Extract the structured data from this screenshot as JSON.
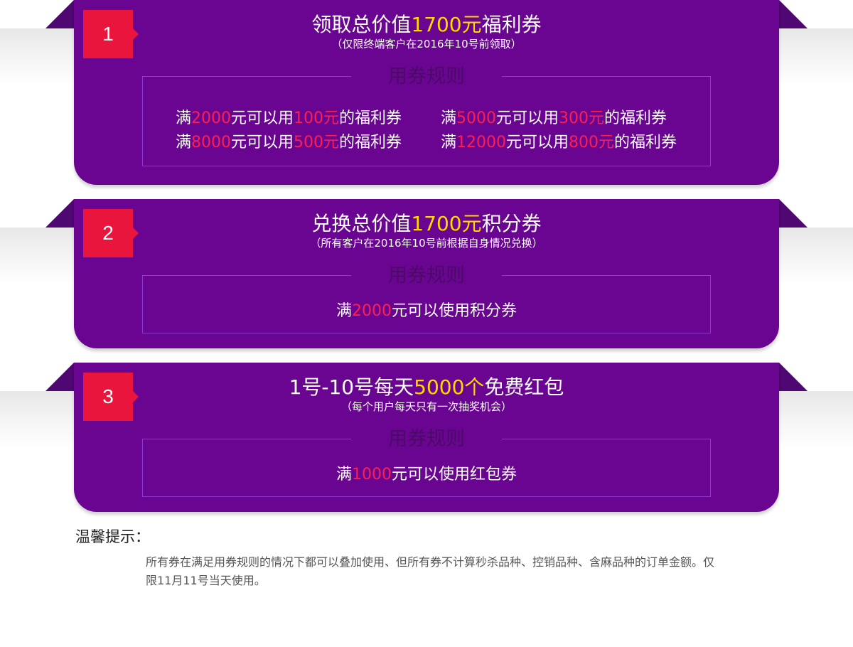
{
  "offers": [
    {
      "badge": "1",
      "title": {
        "before": "领取总价值",
        "highlight": "1700元",
        "after": "福利券"
      },
      "subtitle": "（仅限终端客户在2016年10号前领取）",
      "rules_header": "用券规则",
      "rules": [
        {
          "p1": "满",
          "amt": "2000",
          "p2": "元可以用",
          "val": "100元",
          "p3": "的福利券"
        },
        {
          "p1": "满",
          "amt": "5000",
          "p2": "元可以用",
          "val": "300元",
          "p3": "的福利券"
        },
        {
          "p1": "满",
          "amt": "8000",
          "p2": "元可以用",
          "val": "500元",
          "p3": "的福利券"
        },
        {
          "p1": "满",
          "amt": "12000",
          "p2": "元可以用",
          "val": "800元",
          "p3": "的福利券"
        }
      ]
    },
    {
      "badge": "2",
      "title": {
        "before": "兑换总价值",
        "highlight": "1700元",
        "after": "积分券"
      },
      "subtitle": "（所有客户在2016年10号前根据自身情况兑换）",
      "rules_header": "用券规则",
      "rule": {
        "p1": "满",
        "amt": "2000",
        "p2": "元可以使用积分券"
      }
    },
    {
      "badge": "3",
      "title": {
        "before": "1号-10号每天",
        "highlight": "5000个",
        "after": "免费红包"
      },
      "subtitle": "（每个用户每天只有一次抽奖机会）",
      "rules_header": "用券规则",
      "rule": {
        "p1": "满",
        "amt": "1000",
        "p2": "元可以使用红包券"
      }
    }
  ],
  "tips": {
    "title": "温馨提示：",
    "text": "所有券在满足用券规则的情况下都可以叠加使用、但所有券不计算秒杀品种、控销品种、含麻品种的订单金额。仅限11月11号当天使用。"
  },
  "colors": {
    "panel": "#6a0592",
    "badge": "#e9153c",
    "highlight": "#ffd800",
    "rule_amount": "#ff1f4f"
  }
}
